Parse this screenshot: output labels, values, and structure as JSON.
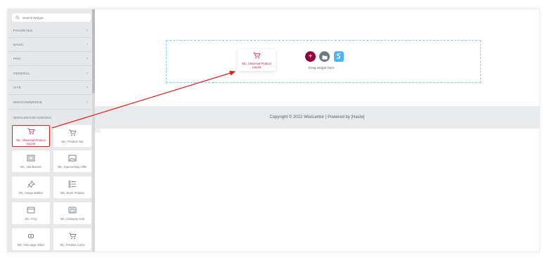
{
  "search": {
    "placeholder": "Search Widget..."
  },
  "categories": [
    {
      "label": "FAVORITES",
      "chevron": "›"
    },
    {
      "label": "BASIC",
      "chevron": "›"
    },
    {
      "label": "PRO",
      "chevron": "›"
    },
    {
      "label": "GENERAL",
      "chevron": "›"
    },
    {
      "label": "SITE",
      "chevron": "›"
    },
    {
      "label": "WOOCOMMERCE",
      "chevron": "›"
    }
  ],
  "woo_section": {
    "title": "WOOLENTOR ADDONS"
  },
  "widgets": [
    {
      "label": "WL: Universal Product Layout",
      "icon": "cart-icon"
    },
    {
      "label": "WL: Product Tab",
      "icon": "cart-icon"
    },
    {
      "label": "WL: Add Banner",
      "icon": "banner-icon"
    },
    {
      "label": "WL: Special Day Offer",
      "icon": "image-icon"
    },
    {
      "label": "WL: Image Marker",
      "icon": "pin-icon"
    },
    {
      "label": "WL: Store Feature",
      "icon": "list-icon"
    },
    {
      "label": "WL: FAQ",
      "icon": "faq-icon"
    },
    {
      "label": "WL: Category Grid",
      "icon": "grid-icon"
    },
    {
      "label": "WL: One page slider",
      "icon": "slider-icon"
    },
    {
      "label": "WL: Product Curvy",
      "icon": "cart-icon"
    }
  ],
  "canvas": {
    "drag_preview_label": "WL: Universal Product Layout",
    "drag_hint": "Drag widget here",
    "add_label": "+"
  },
  "footer": {
    "text": "Copyright © 2022 WooLentor | Powered by [Haste]"
  },
  "colors": {
    "accent": "#93003c",
    "highlight": "#e31d1d",
    "dropzone": "#71d7f7",
    "wl_brand": "#4cb3f5"
  }
}
